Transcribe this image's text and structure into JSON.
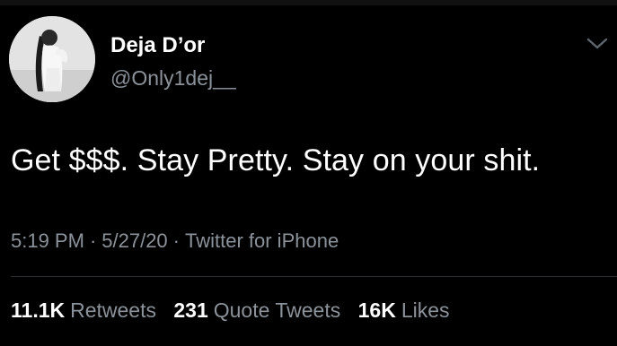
{
  "colors": {
    "background": "#000000",
    "primary_text": "#ffffff",
    "secondary_text": "#8b9299"
  },
  "tweet": {
    "author": {
      "display_name": "Deja D’or",
      "handle": "@Only1dej__",
      "avatar_icon": "profile-photo"
    },
    "menu_icon": "chevron-down-icon",
    "text": "Get $$$. Stay Pretty. Stay on your shit.",
    "time": "5:19 PM",
    "separator": "·",
    "date": "5/27/20",
    "source": "Twitter for iPhone",
    "stats": {
      "retweets_count": "11.1K",
      "retweets_label": "Retweets",
      "quotes_count": "231",
      "quotes_label": "Quote Tweets",
      "likes_count": "16K",
      "likes_label": "Likes"
    }
  }
}
